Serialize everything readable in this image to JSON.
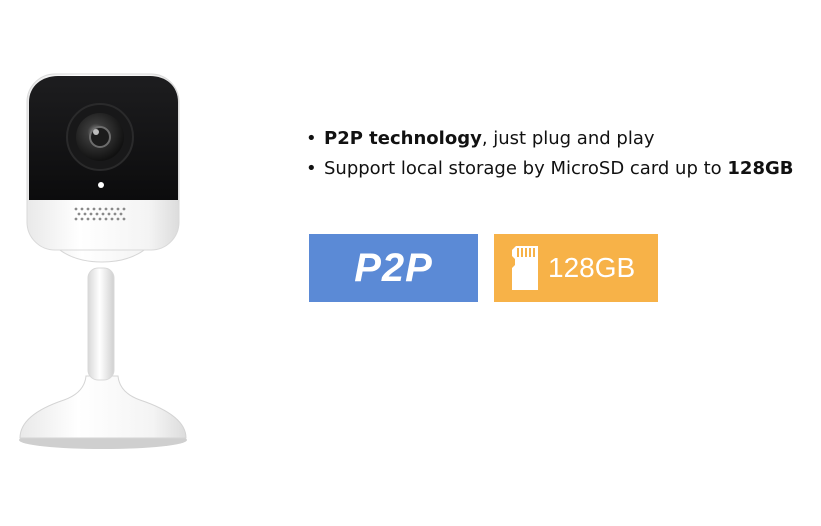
{
  "features": [
    {
      "bold": "P2P technology",
      "rest": ", just plug and play"
    },
    {
      "rest": "Support local storage by MicroSD card up to ",
      "bold": "128GB"
    }
  ],
  "badges": {
    "p2p": {
      "label": "P2P",
      "color": "#5b8ad6"
    },
    "storage": {
      "label": "128GB",
      "color": "#f7b248",
      "icon": "microsd-card-icon"
    }
  },
  "product": {
    "icon": "indoor-camera"
  }
}
